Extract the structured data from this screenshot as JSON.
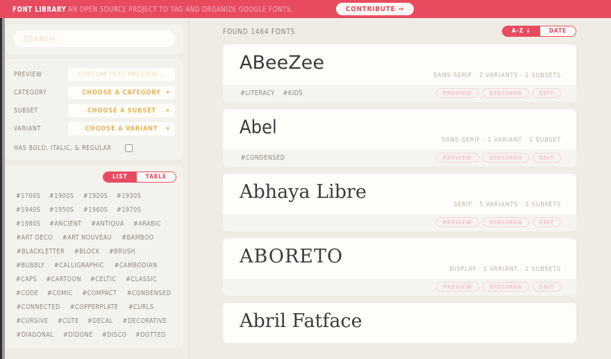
{
  "header": {
    "brand": "FONT LIBRARY",
    "tagline": "AN OPEN SOURCE PROJECT TO TAG AND ORGANIZE GOOGLE FONTS.",
    "contribute_label": "CONTRIBUTE",
    "contribute_arrow": "→",
    "bar_color": "#e84a5f"
  },
  "sidebar": {
    "search": {
      "value": "",
      "placeholder": "SEARCH..."
    },
    "filters": [
      {
        "label": "PREVIEW",
        "value": "CUSTOM TEXT PREVIEW...",
        "is_placeholder": true,
        "has_chevron": false
      },
      {
        "label": "CATEGORY",
        "value": "CHOOSE A CATEGORY",
        "is_placeholder": false,
        "has_chevron": true
      },
      {
        "label": "SUBSET",
        "value": "CHOOSE A SUBSET",
        "is_placeholder": false,
        "has_chevron": true
      },
      {
        "label": "VARIANT",
        "value": "CHOOSE A VARIANT",
        "is_placeholder": false,
        "has_chevron": true
      }
    ],
    "checkbox": {
      "label": "HAS BOLD, ITALIC, & REGULAR",
      "checked": false
    },
    "view_toggle": {
      "options": [
        "LIST",
        "TABLE"
      ],
      "active": "LIST"
    },
    "tags": [
      "#1700S",
      "#1900S",
      "#1920S",
      "#1930S",
      "#1940S",
      "#1950S",
      "#1960S",
      "#1970S",
      "#1980S",
      "#ANCIENT",
      "#ANTIQUA",
      "#ARABIC",
      "#ART DECO",
      "#ART NOUVEAU",
      "#BAMBOO",
      "#BLACKLETTER",
      "#BLOCK",
      "#BRUSH",
      "#BUBBLY",
      "#CALLIGRAPHIC",
      "#CAMBODIAN",
      "#CAPS",
      "#CARTOON",
      "#CELTIC",
      "#CLASSIC",
      "#CODE",
      "#COMIC",
      "#COMPACT",
      "#CONDENSED",
      "#CONNECTED",
      "#COPPERPLATE",
      "#CURLS",
      "#CURSIVE",
      "#CUTE",
      "#DECAL",
      "#DECORATIVE",
      "#DIAGONAL",
      "#DIDONE",
      "#DISCO",
      "#DOTTED"
    ]
  },
  "main": {
    "found_label": "FOUND 1464 FONTS",
    "sort_toggle": {
      "options": [
        "A-Z ↓",
        "DATE"
      ],
      "active": "A-Z ↓"
    },
    "action_labels": [
      "PREVIEW",
      "SPECIMEN",
      "EDIT"
    ],
    "fonts": [
      {
        "name": "ABeeZee",
        "style": "fn-sans",
        "meta": "SANS-SERIF · 2 VARIANTS · 2 SUBSETS",
        "tags": [
          "#LITERACY",
          "#KIDS"
        ]
      },
      {
        "name": "Abel",
        "style": "fn-narrow",
        "meta": "SANS-SERIF · 1 VARIANT · 1 SUBSET",
        "tags": [
          "#CONDENSED"
        ]
      },
      {
        "name": "Abhaya Libre",
        "style": "fn-serif",
        "meta": "SERIF · 5 VARIANTS · 3 SUBSETS",
        "tags": []
      },
      {
        "name": "ABORETO",
        "style": "fn-display",
        "meta": "DISPLAY · 1 VARIANT · 2 SUBSETS",
        "tags": []
      },
      {
        "name": "Abril Fatface",
        "style": "fn-serif",
        "meta": "",
        "tags": []
      }
    ]
  }
}
